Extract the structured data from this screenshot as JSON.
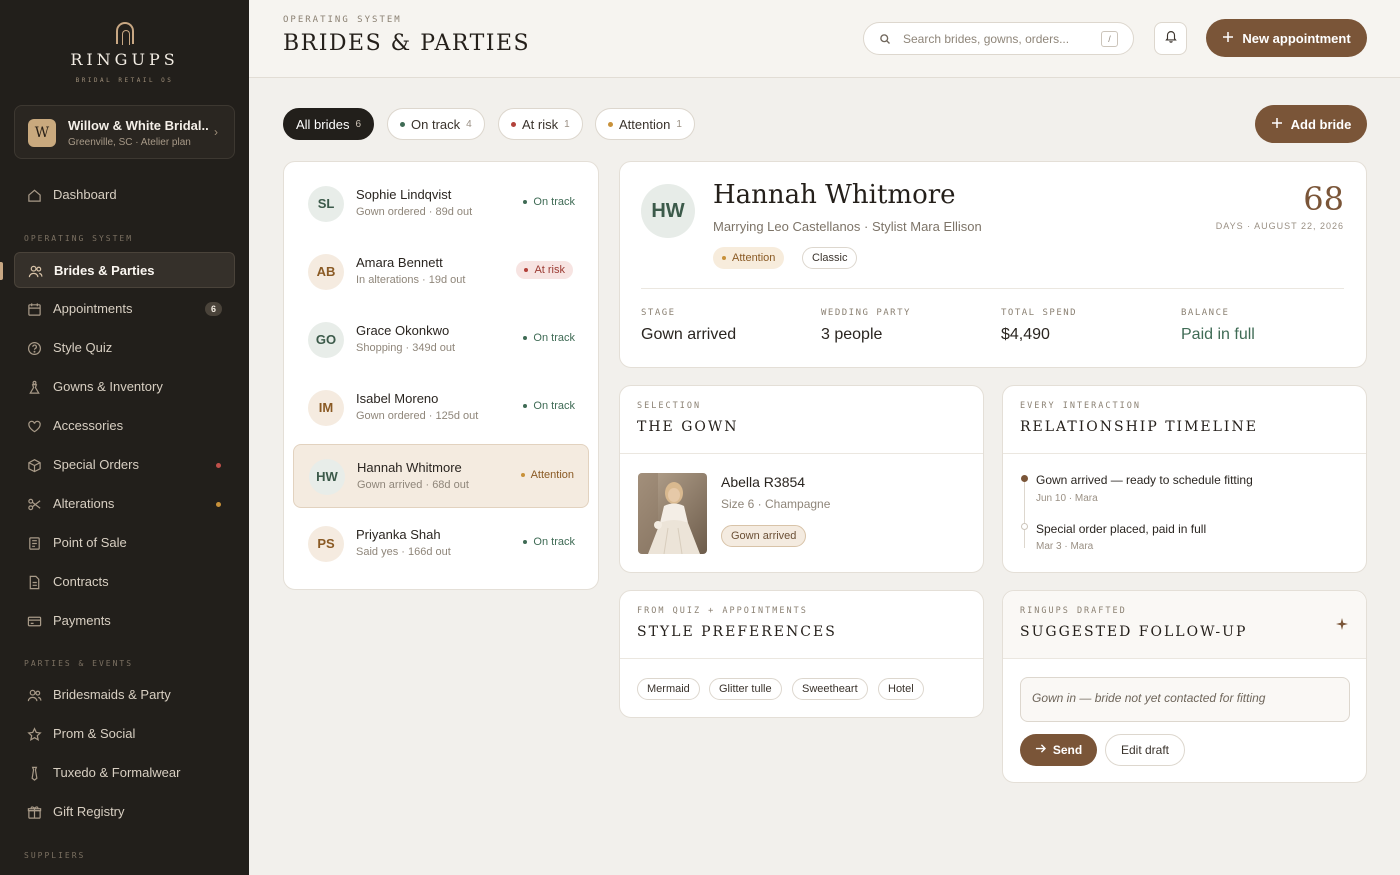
{
  "brand": {
    "name": "RINGUPS",
    "tagline": "BRIDAL RETAIL OS"
  },
  "store": {
    "initial": "W",
    "name": "Willow & White Bridal...",
    "meta": "Greenville, SC · Atelier plan"
  },
  "sidebar": {
    "sections": {
      "operating": "OPERATING SYSTEM",
      "parties": "PARTIES & EVENTS",
      "suppliers": "SUPPLIERS"
    },
    "items": [
      {
        "label": "Dashboard",
        "icon": "home-icon"
      },
      {
        "label": "Brides & Parties",
        "icon": "users-icon",
        "active": true
      },
      {
        "label": "Appointments",
        "icon": "calendar-icon",
        "count": "6"
      },
      {
        "label": "Style Quiz",
        "icon": "question-icon"
      },
      {
        "label": "Gowns & Inventory",
        "icon": "dress-icon"
      },
      {
        "label": "Accessories",
        "icon": "heart-icon"
      },
      {
        "label": "Special Orders",
        "icon": "box-icon",
        "dot": "#c0504a"
      },
      {
        "label": "Alterations",
        "icon": "scissors-icon",
        "dot": "#c8913a"
      },
      {
        "label": "Point of Sale",
        "icon": "register-icon"
      },
      {
        "label": "Contracts",
        "icon": "document-icon"
      },
      {
        "label": "Payments",
        "icon": "card-icon"
      },
      {
        "label": "Bridesmaids & Party",
        "icon": "users-icon"
      },
      {
        "label": "Prom & Social",
        "icon": "star-icon"
      },
      {
        "label": "Tuxedo & Formalwear",
        "icon": "tie-icon"
      },
      {
        "label": "Gift Registry",
        "icon": "gift-icon"
      }
    ]
  },
  "header": {
    "eyebrow": "OPERATING SYSTEM",
    "title": "BRIDES & PARTIES",
    "search_placeholder": "Search brides, gowns, orders...",
    "search_shortcut": "/",
    "new_appointment": "New appointment"
  },
  "filters": [
    {
      "label": "All brides",
      "count": "6",
      "active": true
    },
    {
      "label": "On track",
      "count": "4",
      "dot": "#3f6b55"
    },
    {
      "label": "At risk",
      "count": "1",
      "dot": "#b2413a"
    },
    {
      "label": "Attention",
      "count": "1",
      "dot": "#c8913a"
    }
  ],
  "add_bride": "Add bride",
  "brides": [
    {
      "initials": "SL",
      "name": "Sophie Lindqvist",
      "sub": "Gown ordered · 89d out",
      "status": "On track",
      "kind": "ok"
    },
    {
      "initials": "AB",
      "name": "Amara Bennett",
      "sub": "In alterations · 19d out",
      "status": "At risk",
      "kind": "risk"
    },
    {
      "initials": "GO",
      "name": "Grace Okonkwo",
      "sub": "Shopping · 349d out",
      "status": "On track",
      "kind": "ok"
    },
    {
      "initials": "IM",
      "name": "Isabel Moreno",
      "sub": "Gown ordered · 125d out",
      "status": "On track",
      "kind": "ok"
    },
    {
      "initials": "HW",
      "name": "Hannah Whitmore",
      "sub": "Gown arrived · 68d out",
      "status": "Attention",
      "kind": "attn",
      "selected": true
    },
    {
      "initials": "PS",
      "name": "Priyanka Shah",
      "sub": "Said yes · 166d out",
      "status": "On track",
      "kind": "ok"
    }
  ],
  "detail": {
    "initials": "HW",
    "name": "Hannah Whitmore",
    "subtitle": "Marrying Leo Castellanos · Stylist Mara Ellison",
    "tags": [
      "Attention",
      "Classic"
    ],
    "days": "68",
    "days_label": "DAYS · AUGUST 22, 2026",
    "stats": [
      {
        "label": "STAGE",
        "value": "Gown arrived"
      },
      {
        "label": "WEDDING PARTY",
        "value": "3 people"
      },
      {
        "label": "TOTAL SPEND",
        "value": "$4,490"
      },
      {
        "label": "BALANCE",
        "value": "Paid in full"
      }
    ]
  },
  "gown_card": {
    "eyebrow": "SELECTION",
    "title": "THE GOWN",
    "name": "Abella R3854",
    "meta": "Size 6 · Champagne",
    "tag": "Gown arrived"
  },
  "timeline_card": {
    "eyebrow": "EVERY INTERACTION",
    "title": "RELATIONSHIP TIMELINE",
    "events": [
      {
        "title": "Gown arrived — ready to schedule fitting",
        "meta": "Jun 10 · Mara"
      },
      {
        "title": "Special order placed, paid in full",
        "meta": "Mar 3 · Mara"
      }
    ]
  },
  "prefs_card": {
    "eyebrow": "FROM QUIZ + APPOINTMENTS",
    "title": "STYLE PREFERENCES",
    "chips": [
      "Mermaid",
      "Glitter tulle",
      "Sweetheart",
      "Hotel"
    ]
  },
  "followup_card": {
    "eyebrow": "RINGUPS DRAFTED",
    "title": "SUGGESTED FOLLOW-UP",
    "draft": "Gown in — bride not yet contacted for fitting",
    "send": "Send",
    "edit": "Edit draft"
  },
  "colors": {
    "accent": "#7a5538",
    "sidebar": "#221f1b",
    "ok": "#3f6b55",
    "risk": "#b2413a",
    "attention": "#c8913a"
  }
}
